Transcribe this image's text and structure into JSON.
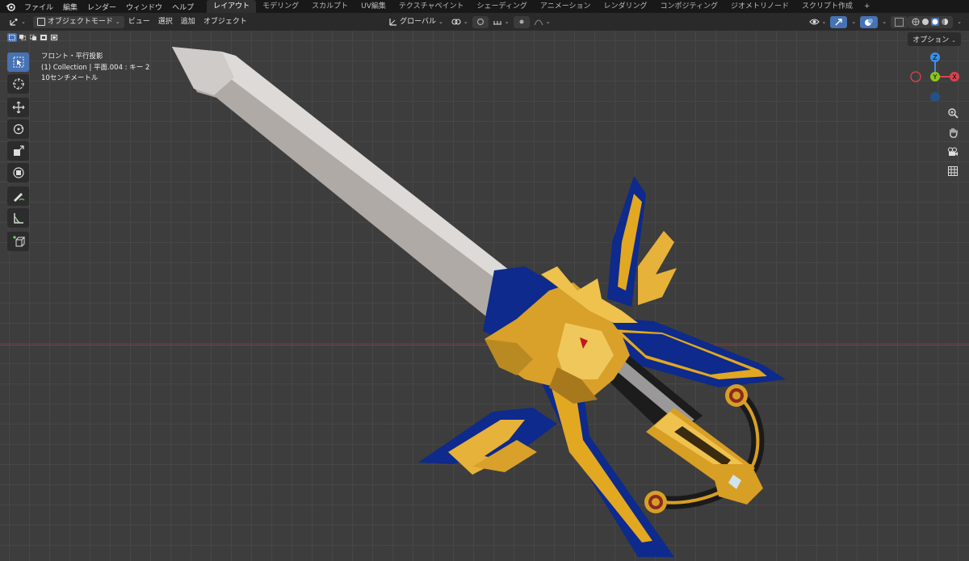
{
  "menu": [
    "ファイル",
    "編集",
    "レンダー",
    "ウィンドウ",
    "ヘルプ"
  ],
  "workspace_tabs": [
    "レイアウト",
    "モデリング",
    "スカルプト",
    "UV編集",
    "テクスチャペイント",
    "シェーディング",
    "アニメーション",
    "レンダリング",
    "コンポジティング",
    "ジオメトリノード",
    "スクリプト作成"
  ],
  "active_tab": "レイアウト",
  "header": {
    "mode": "オブジェクトモード",
    "view": "ビュー",
    "select": "選択",
    "add": "追加",
    "object": "オブジェクト",
    "transform_orientation": "グローバル"
  },
  "options_label": "オプション",
  "viewport_info": {
    "view_name": "フロント・平行投影",
    "collection": "(1) Collection | 平面.004 : キー 2",
    "scale": "10センチメートル"
  },
  "gizmo": {
    "z": "Z",
    "y": "Y",
    "x": "X"
  },
  "colors": {
    "accent": "#4772b3",
    "x_axis": "#d8434f",
    "y_axis": "#8bc61d",
    "z_axis": "#3d8fe6"
  },
  "icons": [
    "blender-logo-icon",
    "editor-type-icon",
    "select-box-icon",
    "cursor-icon",
    "move-icon",
    "rotate-icon",
    "scale-icon",
    "transform-icon",
    "annotate-icon",
    "measure-icon",
    "add-cube-icon",
    "zoom-icon",
    "hand-icon",
    "camera-icon",
    "grid-icon"
  ]
}
